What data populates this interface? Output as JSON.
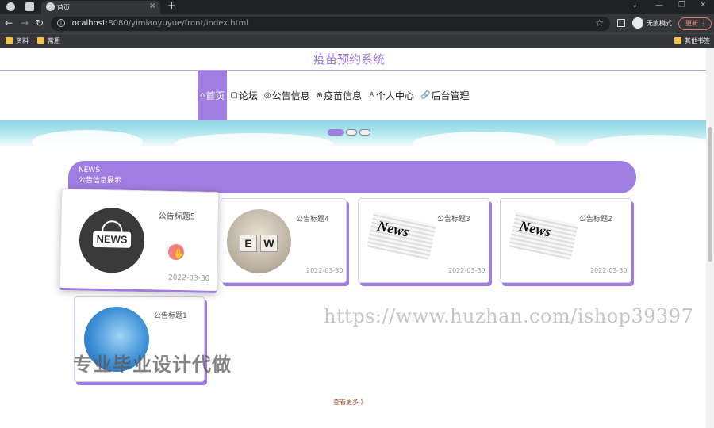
{
  "browser": {
    "tab_title": "首页",
    "new_tab": "+",
    "url_host": "localhost",
    "url_rest": ":8080/yimiaoyuyue/front/index.html",
    "incognito_label": "无痕模式",
    "update_label": "更新",
    "bookmarks": [
      "资料",
      "常用"
    ],
    "other_bookmarks": "其他书签"
  },
  "site": {
    "title": "疫苗预约系统"
  },
  "nav": [
    {
      "icon": "⌂",
      "label": "首页",
      "active": true
    },
    {
      "icon": "▢",
      "label": "论坛"
    },
    {
      "icon": "◎",
      "label": "公告信息"
    },
    {
      "icon": "⊕",
      "label": "疫苗信息"
    },
    {
      "icon": "♙",
      "label": "个人中心"
    },
    {
      "icon": "🔗",
      "label": "后台管理"
    }
  ],
  "news": {
    "header_en": "NEWS",
    "header_cn": "公告信息展示",
    "cards": [
      {
        "title": "公告标题5",
        "date": "2022-03-30",
        "image": "news-globe-logo"
      },
      {
        "title": "公告标题4",
        "date": "2022-03-30",
        "image": "ew-blocks"
      },
      {
        "title": "公告标题3",
        "date": "2022-03-30",
        "image": "newspaper"
      },
      {
        "title": "公告标题2",
        "date": "2022-03-30",
        "image": "newspaper"
      },
      {
        "title": "公告标题1",
        "date": "",
        "image": "blue-news"
      }
    ],
    "ew_letters": [
      "E",
      "W"
    ],
    "news_word": "NEWS",
    "paper_word": "News",
    "more_label": "查看更多 》"
  },
  "watermarks": {
    "url": "https://www.huzhan.com/ishop39397",
    "cn": "专业毕业设计代做"
  },
  "colors": {
    "accent": "#a07de0",
    "title": "#9b7ae0"
  }
}
